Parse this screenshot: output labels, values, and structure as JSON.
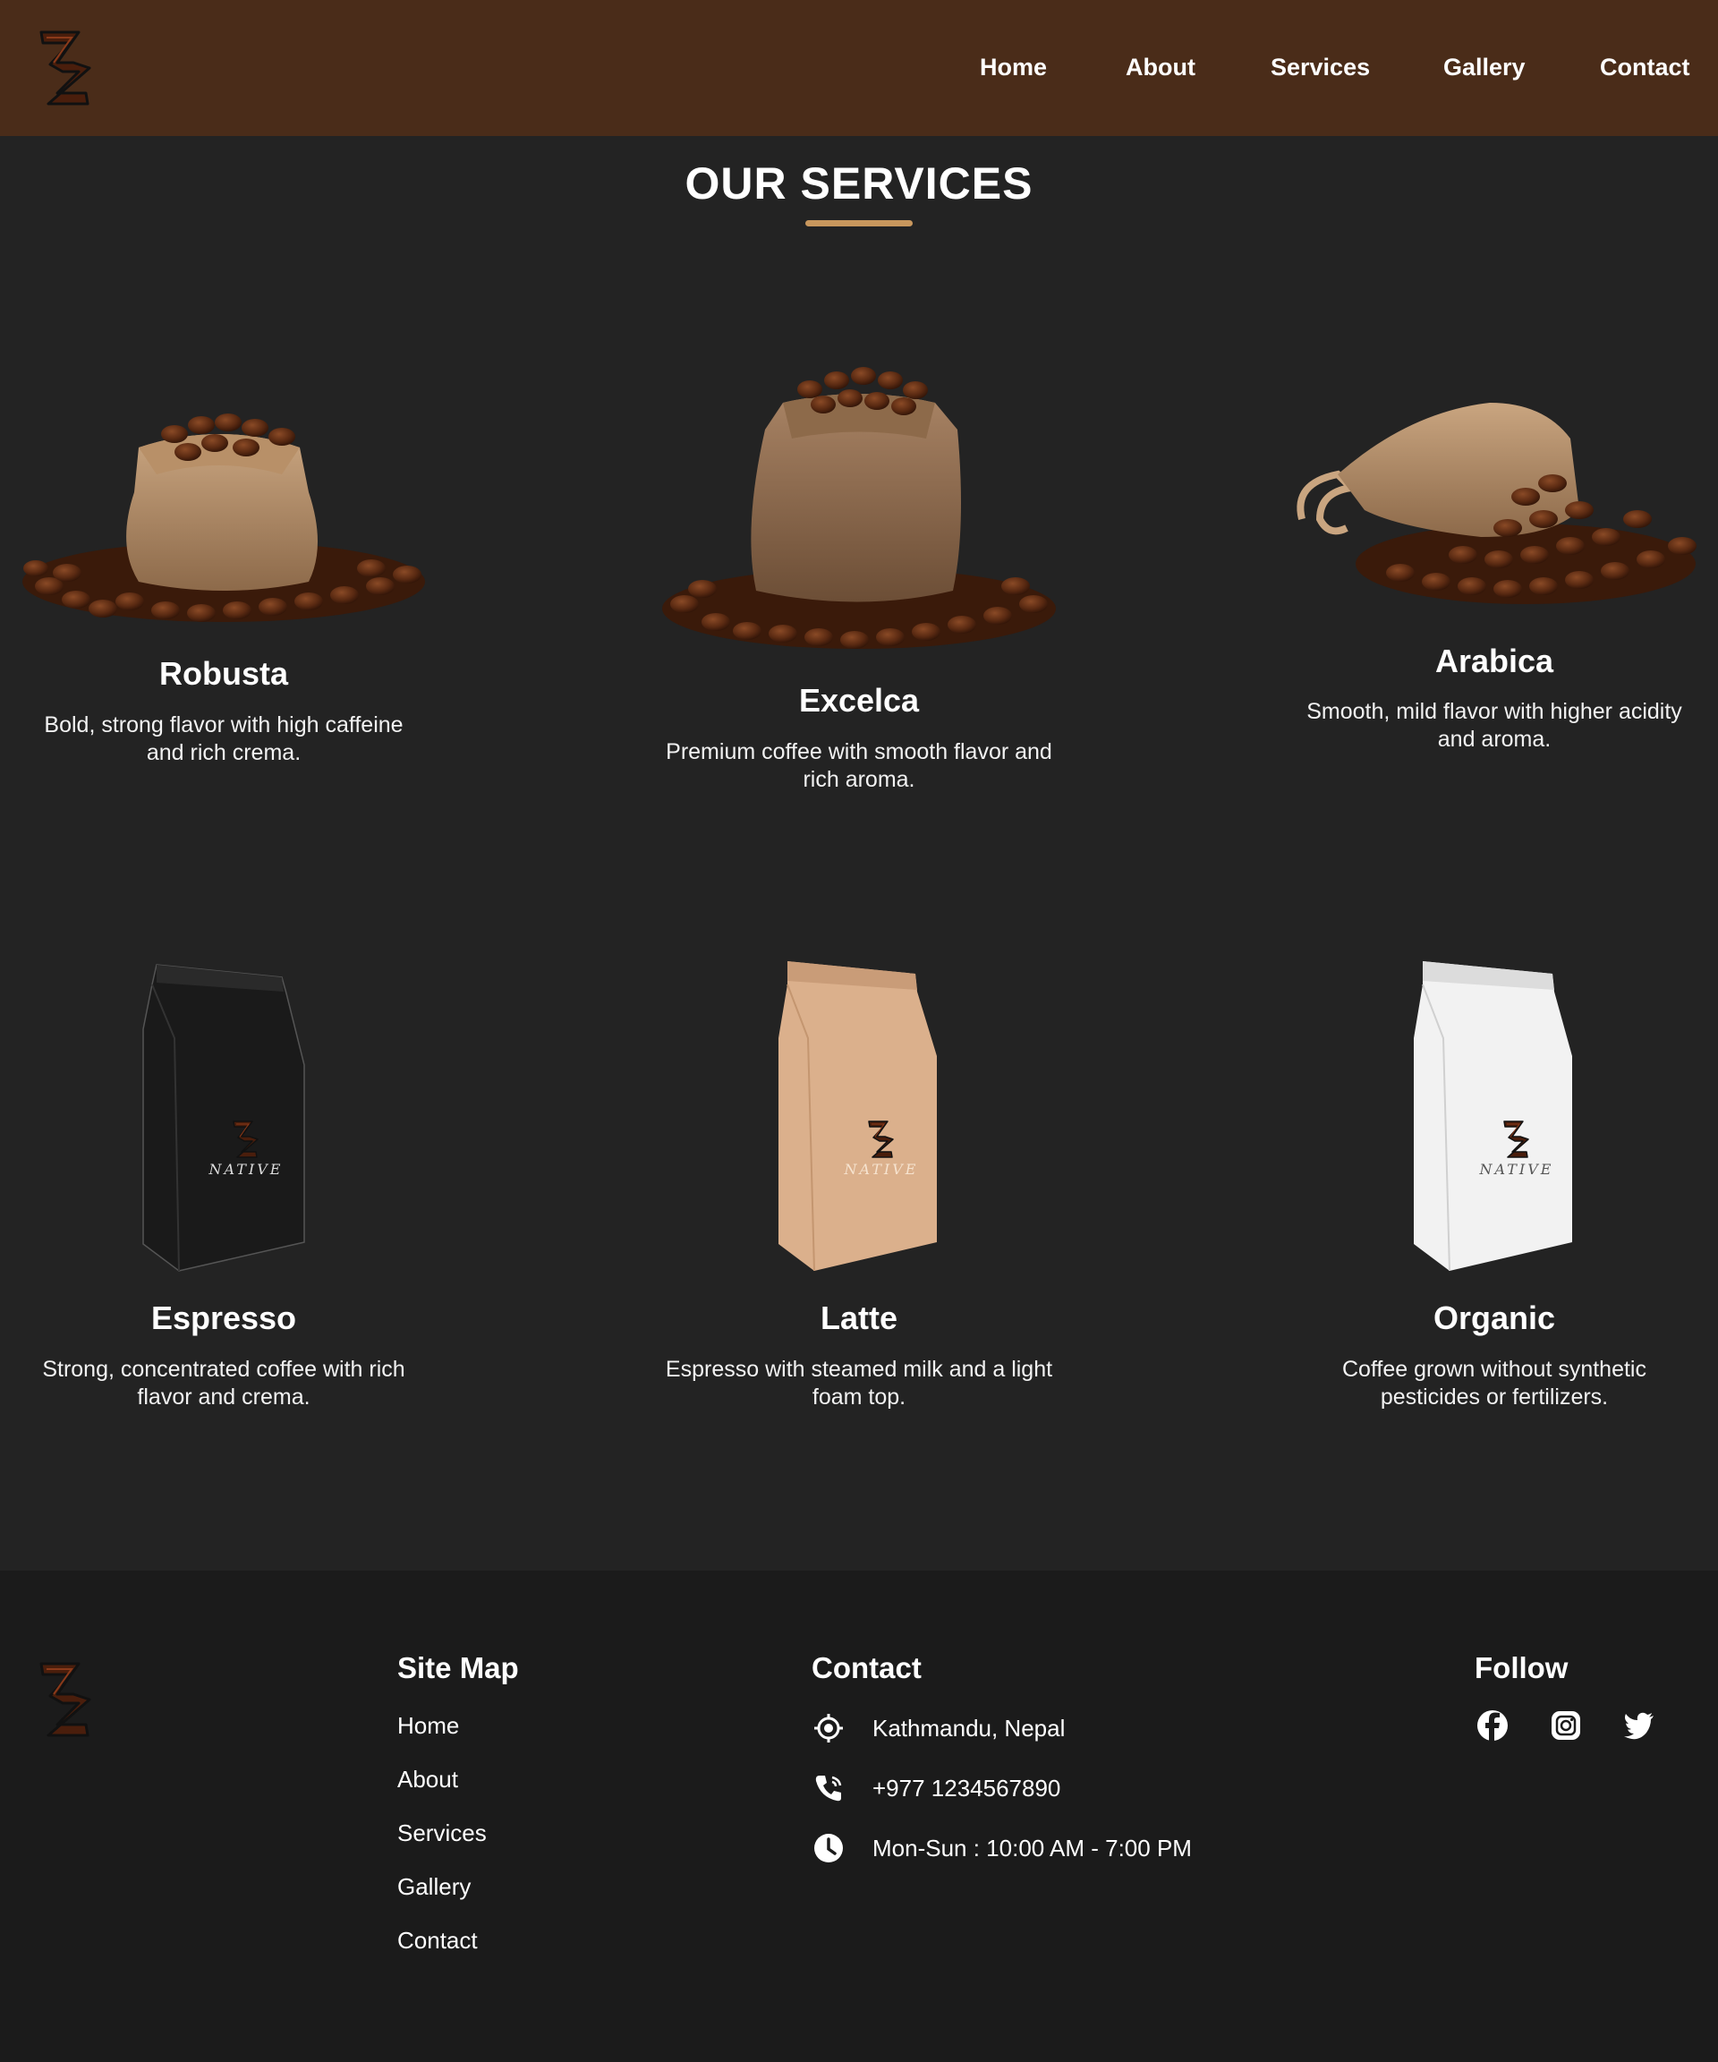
{
  "header": {
    "logo_icon": "zz-logo-icon",
    "nav": [
      "Home",
      "About",
      "Services",
      "Gallery",
      "Contact"
    ]
  },
  "services": {
    "title": "OUR SERVICES",
    "items": [
      {
        "name": "Robusta",
        "desc": "Bold, strong flavor with high caffeine and rich crema.",
        "image": "coffee-sack-image"
      },
      {
        "name": "Excelca",
        "desc": "Premium coffee with smooth flavor and rich aroma.",
        "image": "coffee-sack-image"
      },
      {
        "name": "Arabica",
        "desc": "Smooth, mild flavor with higher acidity and aroma.",
        "image": "coffee-sack-spilled-image"
      },
      {
        "name": "Espresso",
        "desc": "Strong, concentrated coffee with rich flavor and crema.",
        "image": "black-coffee-bag-image"
      },
      {
        "name": "Latte",
        "desc": "Espresso with steamed milk and a light foam top.",
        "image": "kraft-coffee-bag-image"
      },
      {
        "name": "Organic",
        "desc": "Coffee grown without synthetic pesticides or fertilizers.",
        "image": "white-coffee-bag-image"
      }
    ],
    "bag_brand": "NATIVE"
  },
  "footer": {
    "sitemap": {
      "heading": "Site Map",
      "links": [
        "Home",
        "About",
        "Services",
        "Gallery",
        "Contact"
      ]
    },
    "contact": {
      "heading": "Contact",
      "address": "Kathmandu, Nepal",
      "phone": "+977 1234567890",
      "hours": "Mon-Sun : 10:00 AM - 7:00 PM"
    },
    "follow": {
      "heading": "Follow",
      "icons": [
        "facebook-icon",
        "instagram-icon",
        "twitter-icon"
      ]
    }
  },
  "colors": {
    "header_bg": "#4a2c19",
    "page_bg": "#232323",
    "footer_bg": "#1b1b1b",
    "accent": "#c8975d"
  }
}
